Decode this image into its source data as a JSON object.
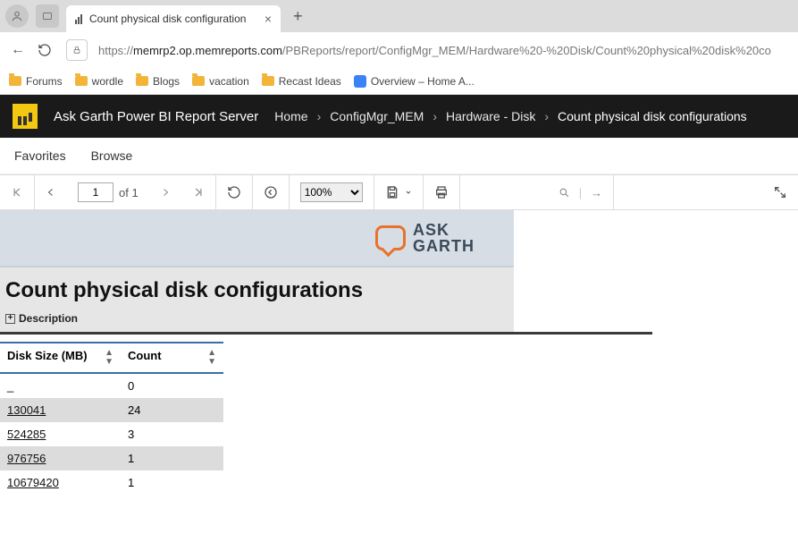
{
  "browser": {
    "tab_title": "Count physical disk configuration",
    "url_prefix": "https://",
    "url_host": "memrp2.op.memreports.com",
    "url_path": "/PBReports/report/ConfigMgr_MEM/Hardware%20-%20Disk/Count%20physical%20disk%20co",
    "bookmarks": [
      "Forums",
      "wordle",
      "Blogs",
      "vacation",
      "Recast Ideas",
      "Overview – Home A..."
    ]
  },
  "header": {
    "server_label": "Ask Garth Power BI Report Server",
    "crumbs": [
      "Home",
      "ConfigMgr_MEM",
      "Hardware - Disk",
      "Count physical disk configurations"
    ]
  },
  "subnav": {
    "favorites": "Favorites",
    "browse": "Browse"
  },
  "toolbar": {
    "page_current": "1",
    "page_of_label": "of 1",
    "zoom": "100%"
  },
  "banner": {
    "logo_top": "ASK",
    "logo_bottom": "GARTH"
  },
  "report": {
    "title": "Count physical disk configurations",
    "description_label": "Description",
    "columns": {
      "disk": "Disk Size (MB)",
      "count": "Count"
    },
    "rows": [
      {
        "disk": "_",
        "count": "0",
        "link": false
      },
      {
        "disk": "130041",
        "count": "24",
        "link": true
      },
      {
        "disk": "524285",
        "count": "3",
        "link": true
      },
      {
        "disk": "976756",
        "count": "1",
        "link": true
      },
      {
        "disk": "10679420",
        "count": "1",
        "link": true
      }
    ]
  },
  "chart_data": {
    "type": "table",
    "title": "Count physical disk configurations",
    "columns": [
      "Disk Size (MB)",
      "Count"
    ],
    "rows": [
      [
        null,
        0
      ],
      [
        130041,
        24
      ],
      [
        524285,
        3
      ],
      [
        976756,
        1
      ],
      [
        10679420,
        1
      ]
    ]
  }
}
